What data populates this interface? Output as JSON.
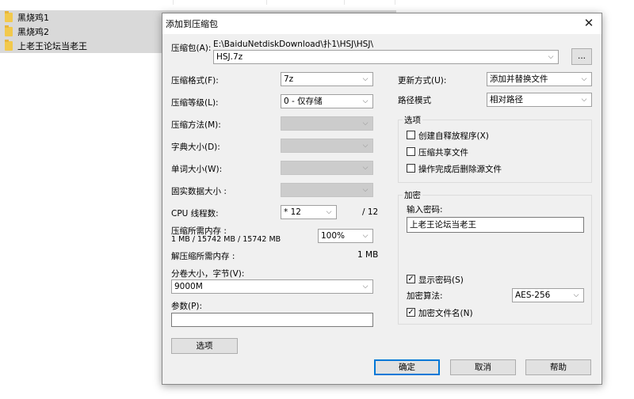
{
  "explorer": {
    "rows": [
      {
        "name": "黑烧鸡1"
      },
      {
        "name": "黑烧鸡2"
      },
      {
        "name": "上老王论坛当老王"
      }
    ]
  },
  "dialog": {
    "title": "添加到压缩包",
    "archive": {
      "label": "压缩包(A):",
      "path": "E:\\BaiduNetdiskDownload\\扑1\\HSJ\\HSJ\\",
      "filename": "HSJ.7z",
      "browse_label": "..."
    },
    "left": {
      "format": {
        "label": "压缩格式(F):",
        "value": "7z"
      },
      "level": {
        "label": "压缩等级(L):",
        "value": "0 - 仅存储"
      },
      "method": {
        "label": "压缩方法(M):",
        "value": ""
      },
      "dict": {
        "label": "字典大小(D):",
        "value": ""
      },
      "word": {
        "label": "单词大小(W):",
        "value": ""
      },
      "solid": {
        "label": "固实数据大小 :",
        "value": ""
      },
      "cpu": {
        "label": "CPU 线程数:",
        "value": "* 12",
        "max": "/ 12"
      },
      "mem_comp": {
        "label": "压缩所需内存 :",
        "detail": "1 MB / 15742 MB / 15742 MB",
        "value": "100%"
      },
      "mem_decomp": {
        "label": "解压缩所需内存 :",
        "value": "1 MB"
      },
      "volume": {
        "label": "分卷大小，字节(V):",
        "value": "9000M"
      },
      "params": {
        "label": "参数(P):",
        "value": ""
      },
      "options_button": "选项"
    },
    "right": {
      "update": {
        "label": "更新方式(U):",
        "value": "添加并替换文件"
      },
      "path_mode": {
        "label": "路径模式",
        "value": "相对路径"
      },
      "options": {
        "title": "选项",
        "sfx": {
          "label": "创建自释放程序(X)",
          "checked": false
        },
        "shared": {
          "label": "压缩共享文件",
          "checked": false
        },
        "delete": {
          "label": "操作完成后删除源文件",
          "checked": false
        }
      },
      "encryption": {
        "title": "加密",
        "password_label": "输入密码:",
        "password_value": "上老王论坛当老王",
        "show_password": {
          "label": "显示密码(S)",
          "checked": true
        },
        "method_label": "加密算法:",
        "method_value": "AES-256",
        "encrypt_names": {
          "label": "加密文件名(N)",
          "checked": true
        }
      }
    },
    "buttons": {
      "ok": "确定",
      "cancel": "取消",
      "help": "帮助"
    }
  }
}
